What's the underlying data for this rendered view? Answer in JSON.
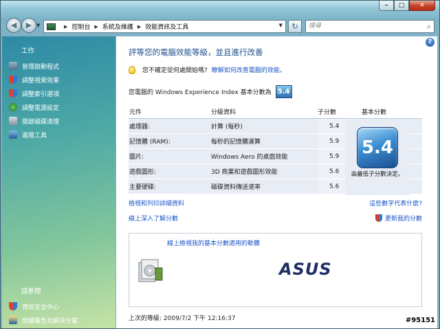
{
  "window": {
    "close_label": "✕",
    "max_label": "□",
    "min_label": "–"
  },
  "nav": {
    "breadcrumbs": [
      "控制台",
      "系統及維護",
      "效能資訊及工具"
    ],
    "search_placeholder": "搜尋"
  },
  "sidebar": {
    "title": "工作",
    "items": [
      "管理啟動程式",
      "調整視覺效果",
      "調整索引選項",
      "調整電源設定",
      "開啟磁碟清理",
      "進階工具"
    ],
    "see_also_title": "請參閱",
    "see_also": [
      "資訊安全中心",
      "問題報告及解決方案"
    ]
  },
  "main": {
    "heading": "評等您的電腦效能等級，並且進行改善",
    "tip_question": "您不確定從何處開始嗎?",
    "tip_link": "瞭解如何改善電腦的效能。",
    "score_label": "您電腦的 Windows Experience Index 基本分數為",
    "score": "5.4",
    "columns": [
      "元件",
      "分級資料",
      "子分數",
      "基本分數"
    ],
    "rows": [
      {
        "component": "處理器:",
        "detail": "計算 (每秒)",
        "subscore": "5.4"
      },
      {
        "component": "記憶體 (RAM):",
        "detail": "每秒的記憶體運算",
        "subscore": "5.9"
      },
      {
        "component": "圖片:",
        "detail": "Windows Aero 的桌面效能",
        "subscore": "5.9"
      },
      {
        "component": "遊戲圖形:",
        "detail": "3D 商業和遊戲圖形效能",
        "subscore": "5.6"
      },
      {
        "component": "主要硬碟:",
        "detail": "磁碟資料傳送速率",
        "subscore": "5.6"
      }
    ],
    "base_caption": "由最低子分數決定。",
    "link_print": "檢視和列印詳細資料",
    "link_meaning": "這些數字代表什麼?",
    "link_online": "線上深入了解分數",
    "link_update": "更新我的分數",
    "panel_link": "線上檢視我的基本分數適用的軟體",
    "oem_logo": "ASUS",
    "last_rated": "上次的等級: 2009/7/2 下午 12:16:37"
  },
  "watermark": "#95151",
  "colors": {
    "link": "#1a56c8",
    "heading": "#1d4e8c",
    "sidebar_top": "#2d8aa5",
    "sidebar_bottom": "#c6e3a6"
  }
}
